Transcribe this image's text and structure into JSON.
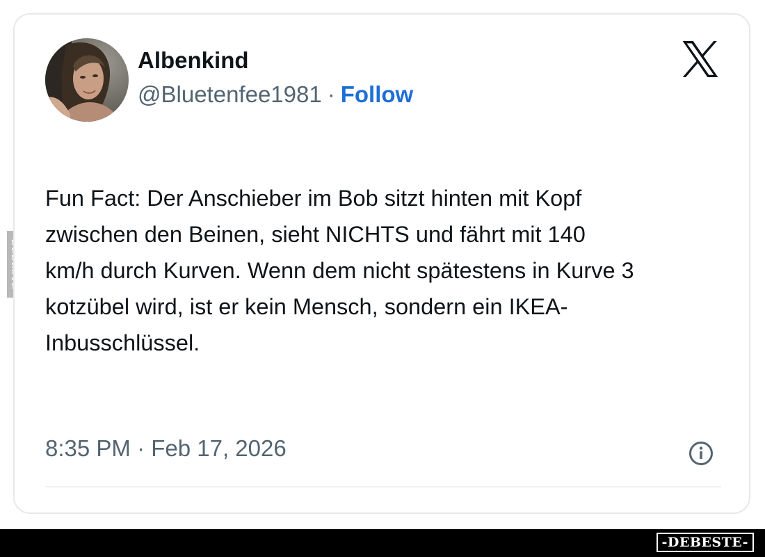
{
  "tweet": {
    "display_name": "Albenkind",
    "handle": "@Bluetenfee1981",
    "separator": "·",
    "follow_label": "Follow",
    "text_lines": [
      "Fun Fact: Der Anschieber im Bob sitzt hinten mit Kopf",
      "zwischen den Beinen, sieht NICHTS und fährt mit 140",
      "km/h durch Kurven. Wenn dem nicht spätestens in Kurve 3",
      "kotzübel wird, ist er kein Mensch, sondern ein IKEA-",
      "Inbusschlüssel."
    ],
    "timestamp": "8:35 PM · Feb 17, 2026"
  },
  "icons": {
    "brand": "x-logo-icon",
    "info": "info-icon",
    "avatar": "avatar-photo"
  },
  "watermark": {
    "side_text": "DEBESTE",
    "bottom_text": "-DEBESTE-"
  },
  "colors": {
    "text_primary": "#0f1419",
    "text_secondary": "#536471",
    "follow_link": "#1d6fd6",
    "card_border": "#e6e9ec",
    "bottom_bar": "#000000"
  }
}
